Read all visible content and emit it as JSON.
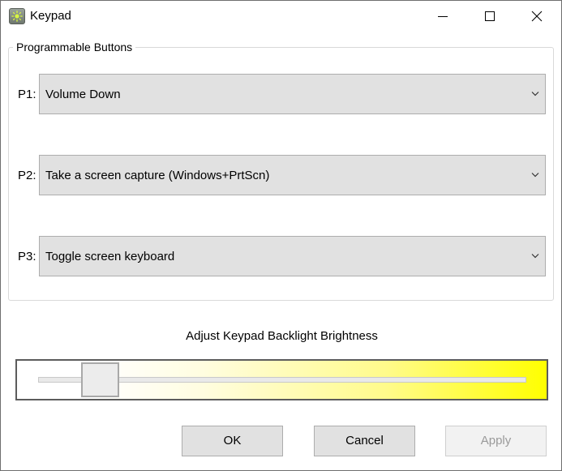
{
  "window": {
    "title": "Keypad",
    "icon": "keypad-app-icon"
  },
  "caption_buttons": {
    "minimize_icon": "minimize-icon",
    "maximize_icon": "maximize-icon",
    "close_icon": "close-icon"
  },
  "programmable_buttons": {
    "group_title": "Programmable Buttons",
    "rows": [
      {
        "label": "P1:",
        "value": "Volume Down"
      },
      {
        "label": "P2:",
        "value": "Take a screen capture (Windows+PrtScn)"
      },
      {
        "label": "P3:",
        "value": "Toggle screen keyboard"
      }
    ]
  },
  "backlight": {
    "label": "Adjust Keypad Backlight Brightness",
    "level_fraction": 0.1,
    "gradient_end_color": "#ffff00"
  },
  "buttons": {
    "ok": "OK",
    "cancel": "Cancel",
    "apply": "Apply",
    "apply_disabled": true
  }
}
